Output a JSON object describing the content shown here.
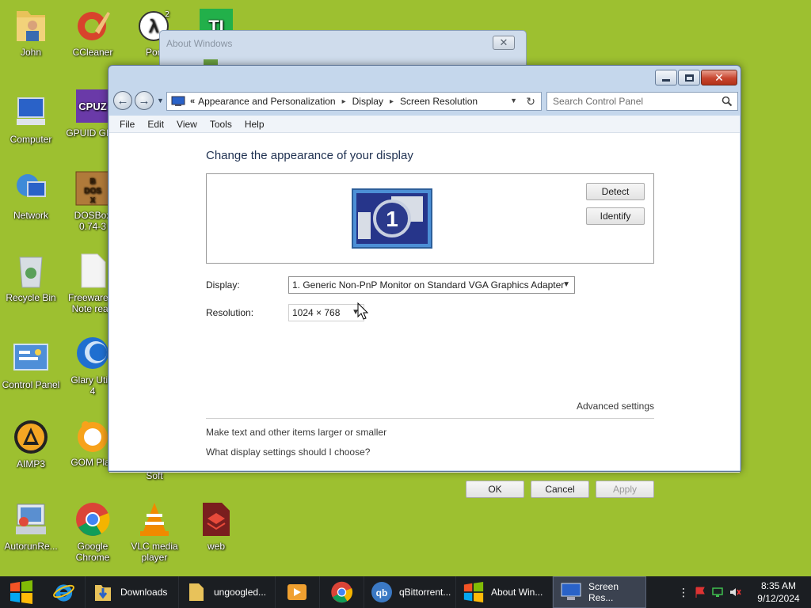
{
  "desktop": {
    "icons": [
      {
        "label": "John"
      },
      {
        "label": "CCleaner"
      },
      {
        "label": "Port"
      },
      {
        "label": "Computer"
      },
      {
        "label": "GPUID GPU"
      },
      {
        "label": "Network"
      },
      {
        "label": "DOSBox\n0.74-3"
      },
      {
        "label": "Recycle Bin"
      },
      {
        "label": "Freeware S\nNote read"
      },
      {
        "label": "Control Panel"
      },
      {
        "label": "Glary Utilit\n4"
      },
      {
        "label": "AIMP3"
      },
      {
        "label": "GOM Play"
      },
      {
        "label": "Soft"
      },
      {
        "label": "AutorunRe..."
      },
      {
        "label": "Google\nChrome"
      },
      {
        "label": "VLC media\nplayer"
      },
      {
        "label": "web"
      }
    ],
    "background_color": "#9dc030"
  },
  "background_window": {
    "title": "About Windows",
    "close_glyph": "✕"
  },
  "window": {
    "nav": {
      "back_glyph": "←",
      "forward_glyph": "→",
      "chevrons": "«",
      "breadcrumbs": [
        "Appearance and Personalization",
        "Display",
        "Screen Resolution"
      ],
      "crumb_separator": "▸",
      "search_placeholder": "Search Control Panel"
    },
    "menu": [
      "File",
      "Edit",
      "View",
      "Tools",
      "Help"
    ],
    "content": {
      "title": "Change the appearance of your display",
      "monitor_number": "1",
      "detect_label": "Detect",
      "identify_label": "Identify",
      "display_label": "Display:",
      "display_value": "1. Generic Non-PnP Monitor on Standard VGA Graphics Adapter",
      "resolution_label": "Resolution:",
      "resolution_value": "1024 × 768",
      "advanced_link": "Advanced settings",
      "link_text_size": "Make text and other items larger or smaller",
      "link_help": "What display settings should I choose?",
      "ok_label": "OK",
      "cancel_label": "Cancel",
      "apply_label": "Apply"
    }
  },
  "taskbar": {
    "items": [
      {
        "label": "Downloads"
      },
      {
        "label": "ungoogled..."
      },
      {
        "label": "qBittorrent..."
      },
      {
        "label": "About Win..."
      },
      {
        "label": "Screen Res..."
      }
    ],
    "time": "8:35 AM",
    "date": "9/12/2024"
  }
}
